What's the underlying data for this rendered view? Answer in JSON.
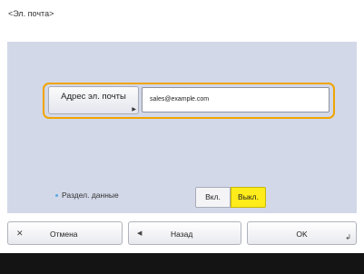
{
  "header": {
    "title": "<Эл. почта>"
  },
  "form": {
    "address_label": "Адрес эл. почты",
    "address_value": "sales@example.com",
    "split_label": "Раздел. данные",
    "split_on": "Вкл.",
    "split_off": "Выкл.",
    "split_selected": "Выкл."
  },
  "footer": {
    "cancel": "Отмена",
    "back": "Назад",
    "ok": "OK"
  },
  "colors": {
    "panel": "#d3d8e8",
    "focus_outline": "#f0a400",
    "selected_toggle": "#ffec1a",
    "bullet": "#5aa8e6"
  }
}
